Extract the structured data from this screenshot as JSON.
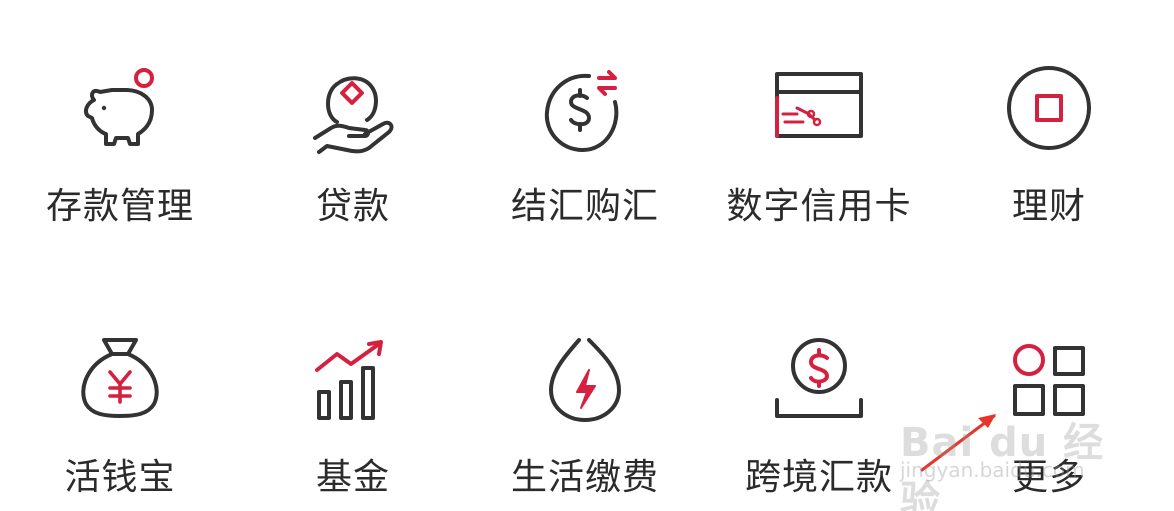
{
  "colors": {
    "icon_dark": "#333333",
    "icon_accent": "#d6203f",
    "label": "#2b2b2b",
    "arrow": "#e8342a"
  },
  "grid": {
    "items": [
      {
        "label": "存款管理",
        "icon": "piggy-bank-icon"
      },
      {
        "label": "贷款",
        "icon": "coin-hand-icon"
      },
      {
        "label": "结汇购汇",
        "icon": "dollar-exchange-icon"
      },
      {
        "label": "数字信用卡",
        "icon": "credit-card-icon"
      },
      {
        "label": "理财",
        "icon": "wealth-circle-icon"
      },
      {
        "label": "活钱宝",
        "icon": "yuan-money-bag-icon"
      },
      {
        "label": "基金",
        "icon": "growth-chart-icon"
      },
      {
        "label": "生活缴费",
        "icon": "utility-drop-icon"
      },
      {
        "label": "跨境汇款",
        "icon": "dollar-coin-tray-icon"
      },
      {
        "label": "更多",
        "icon": "more-apps-icon"
      }
    ]
  },
  "watermark": {
    "brand": "Bai du 经验",
    "url": "jingyan.baidu.com"
  }
}
